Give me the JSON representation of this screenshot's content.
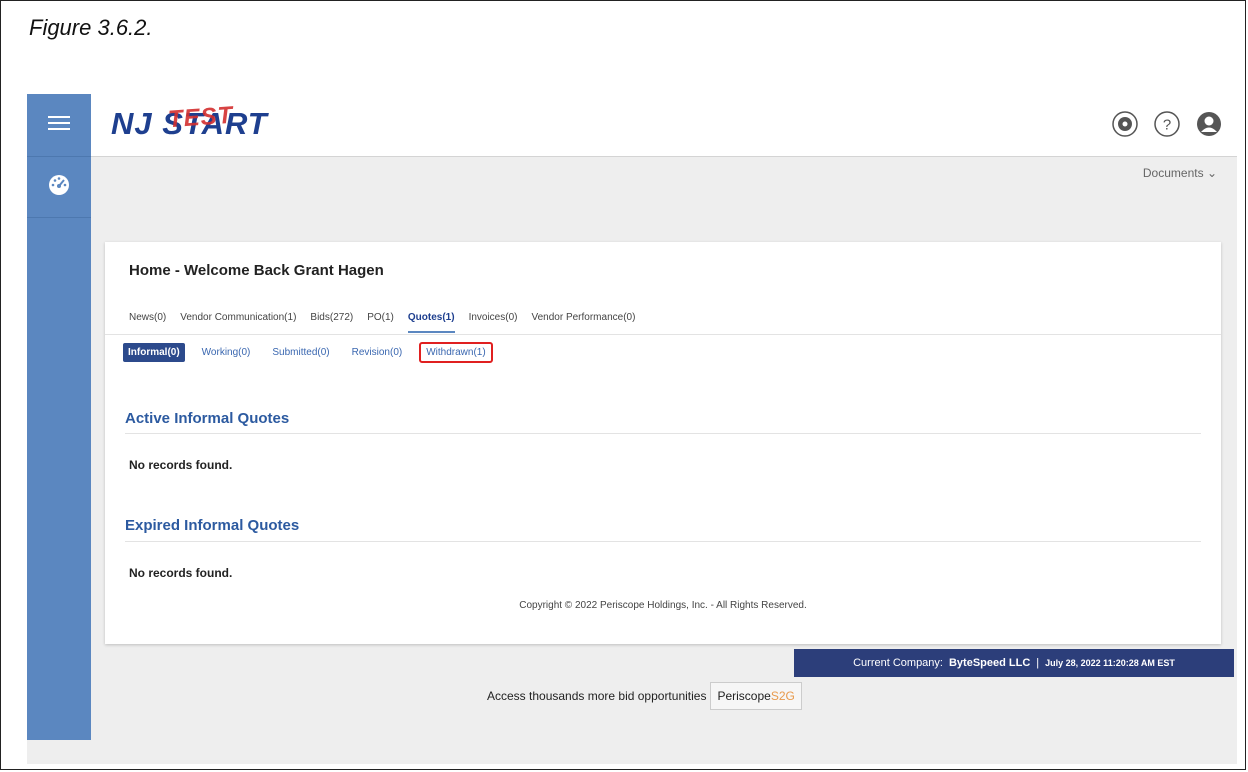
{
  "caption": "Figure 3.6.2.",
  "colors": {
    "sidebar": "#5b87c0",
    "accent": "#2c4a8c",
    "highlight": "#e02020"
  },
  "logo": {
    "nj": "NJ",
    "start": "START",
    "test": "TEST"
  },
  "icons": {
    "menu": "hamburger-icon",
    "dashboard": "dashboard-gauge-icon",
    "settings": "gear-icon",
    "help": "question-icon",
    "user": "user-icon"
  },
  "documents_label": "Documents",
  "welcome": "Home - Welcome Back Grant Hagen",
  "tabs": [
    {
      "label": "News(0)"
    },
    {
      "label": "Vendor Communication(1)"
    },
    {
      "label": "Bids(272)"
    },
    {
      "label": "PO(1)"
    },
    {
      "label": "Quotes(1)"
    },
    {
      "label": "Invoices(0)"
    },
    {
      "label": "Vendor Performance(0)"
    }
  ],
  "subtabs": [
    {
      "label": "Informal(0)"
    },
    {
      "label": "Working(0)"
    },
    {
      "label": "Submitted(0)"
    },
    {
      "label": "Revision(0)"
    },
    {
      "label": "Withdrawn(1)"
    }
  ],
  "sections": {
    "active_title": "Active Informal Quotes",
    "active_empty": "No records found.",
    "expired_title": "Expired Informal Quotes",
    "expired_empty": "No records found."
  },
  "copyright": "Copyright © 2022 Periscope Holdings, Inc. - All Rights Reserved.",
  "company": {
    "label": "Current Company:",
    "name": "ByteSpeed LLC",
    "separator": "|",
    "datetime": "July 28, 2022 11:20:28 AM EST"
  },
  "access": {
    "text": "Access thousands more bid opportunities",
    "button_main": "Periscope",
    "button_accent": "S2G"
  }
}
